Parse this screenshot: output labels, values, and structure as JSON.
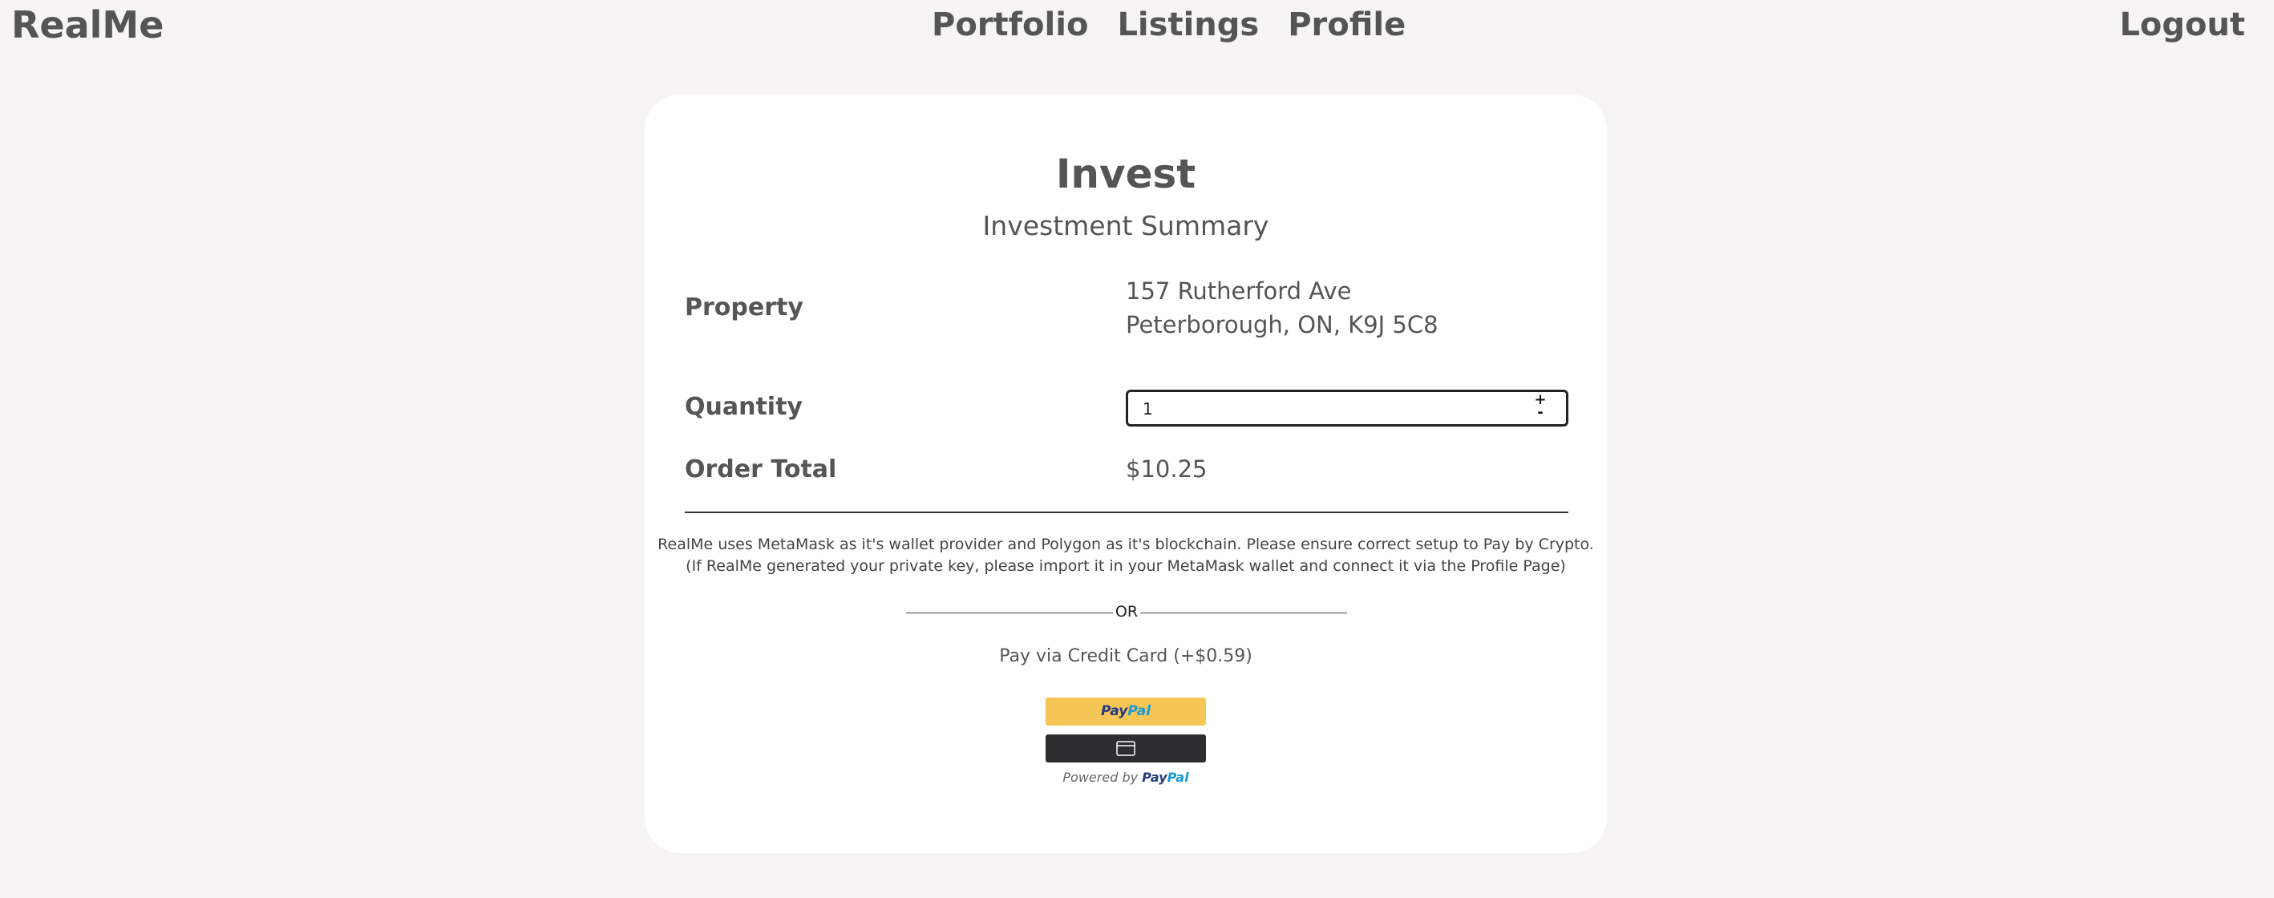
{
  "nav": {
    "logo": "RealMe",
    "links": [
      "Portfolio",
      "Listings",
      "Profile"
    ],
    "logout": "Logout"
  },
  "invest": {
    "title": "Invest",
    "subtitle": "Investment Summary",
    "property_label": "Property",
    "property_line1": "157 Rutherford Ave",
    "property_line2": "Peterborough, ON, K9J 5C8",
    "quantity_label": "Quantity",
    "quantity_value": "1",
    "increment_symbol": "+",
    "decrement_symbol": "-",
    "order_total_label": "Order Total",
    "order_total_value": "$10.25",
    "notice_line1": "RealMe uses MetaMask as it's wallet provider and Polygon as it's blockchain. Please ensure correct setup to Pay by Crypto.",
    "notice_line2": "(If RealMe generated your private key, please import it in your MetaMask wallet and connect it via the Profile Page)",
    "or_text": "OR",
    "credit_card_text": "Pay via Credit Card (+$0.59)",
    "paypal_pay": "Pay",
    "paypal_pal": "Pal",
    "powered_by": "Powered by",
    "card_icon": "credit-card-icon"
  },
  "colors": {
    "background": "#f6f5f3",
    "card": "#ffffff",
    "text": "#555555",
    "paypal_yellow": "#f5c556",
    "card_button": "#2c2e2f",
    "paypal_blue_dark": "#253b80",
    "paypal_blue_light": "#179bd7"
  }
}
